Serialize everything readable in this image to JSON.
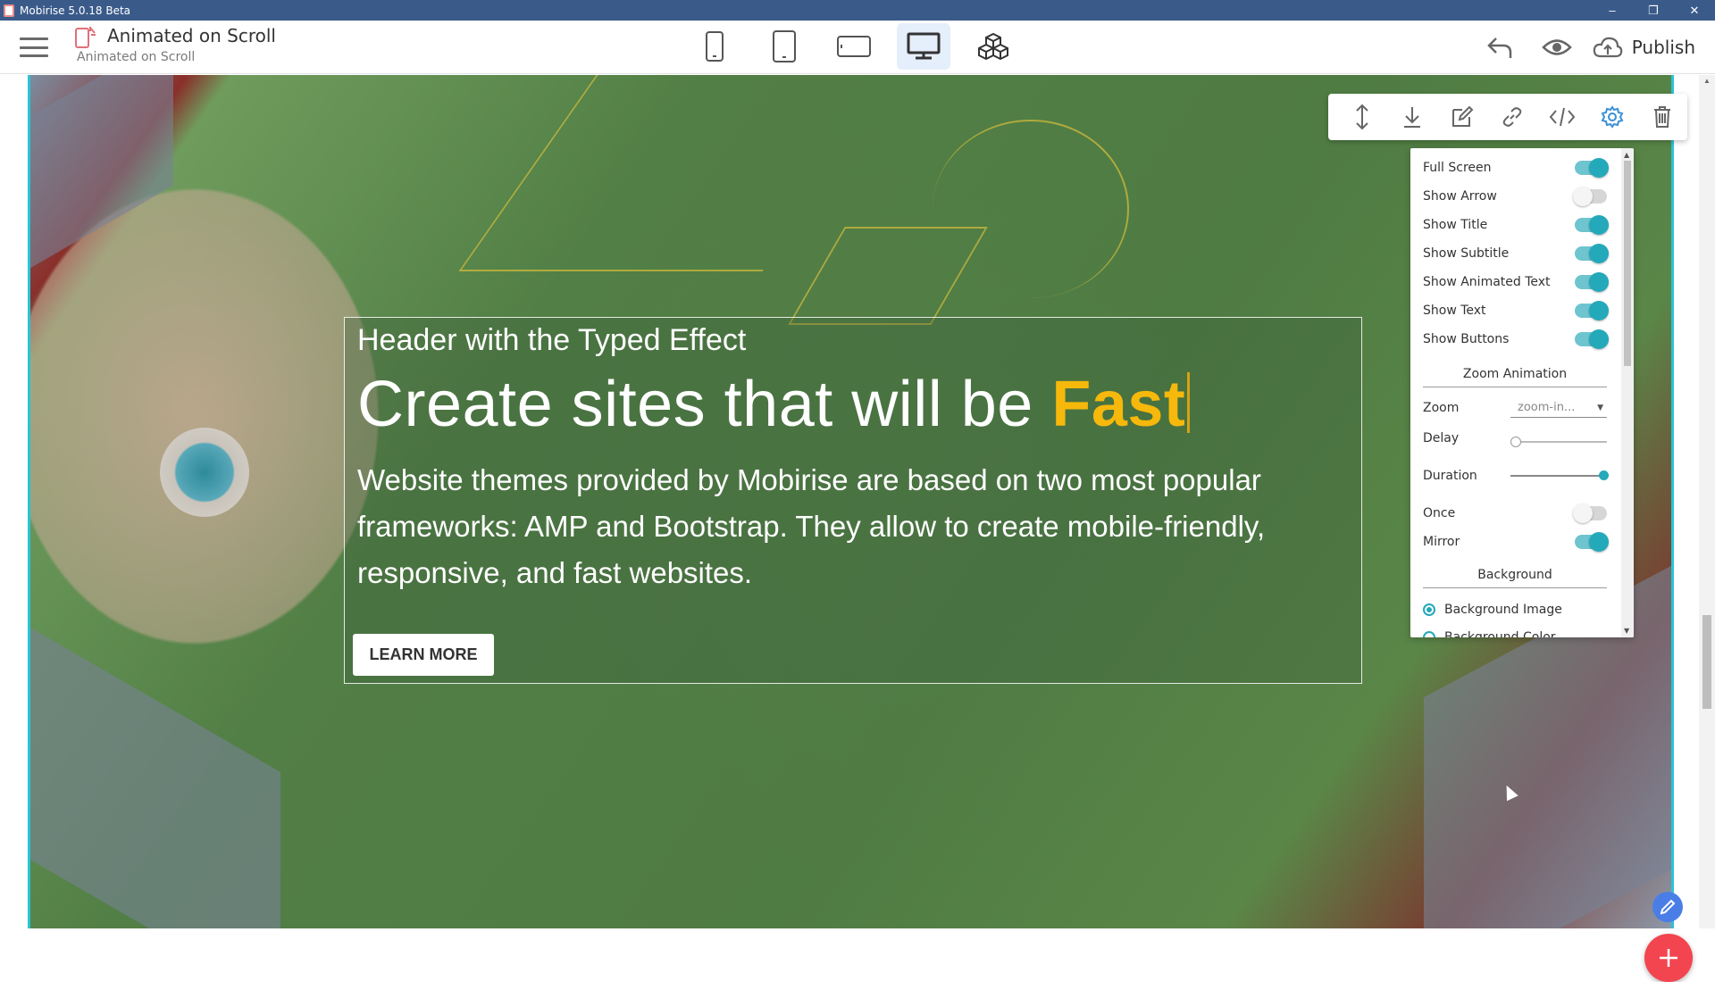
{
  "window": {
    "title": "Mobirise 5.0.18 Beta",
    "controls": [
      "–",
      "❐",
      "✕"
    ]
  },
  "appbar": {
    "page_title": "Animated on Scroll",
    "page_subtitle": "Animated on Scroll",
    "devices": [
      {
        "name": "phone-icon"
      },
      {
        "name": "tablet-icon"
      },
      {
        "name": "tablet-landscape-icon"
      },
      {
        "name": "desktop-icon",
        "active": true
      },
      {
        "name": "blocks-icon"
      }
    ],
    "publish_label": "Publish"
  },
  "hero": {
    "subtitle": "Header with the Typed Effect",
    "title_static": "Create sites that will be ",
    "title_typed": "Fast",
    "text": "Website themes provided by Mobirise are based on two most popular frameworks: AMP and Bootstrap. They allow to create mobile-friendly, responsive, and fast websites.",
    "button_label": "LEARN MORE"
  },
  "toolbar": {
    "icons": [
      "move-icon",
      "download-icon",
      "edit-icon",
      "link-icon",
      "code-icon",
      "gear-icon",
      "trash-icon"
    ]
  },
  "settings": {
    "toggles": [
      {
        "label": "Full Screen",
        "on": true
      },
      {
        "label": "Show Arrow",
        "on": false
      },
      {
        "label": "Show Title",
        "on": true
      },
      {
        "label": "Show Subtitle",
        "on": true
      },
      {
        "label": "Show Animated Text",
        "on": true
      },
      {
        "label": "Show Text",
        "on": true
      },
      {
        "label": "Show Buttons",
        "on": true
      }
    ],
    "zoom_section": "Zoom Animation",
    "zoom_label": "Zoom",
    "zoom_value": "zoom-in...",
    "delay_label": "Delay",
    "delay_value": 0,
    "duration_label": "Duration",
    "duration_value": 1,
    "once_label": "Once",
    "once_on": false,
    "mirror_label": "Mirror",
    "mirror_on": true,
    "background_section": "Background",
    "bg_option_1": "Background Image",
    "bg_option_2": "Background Color"
  },
  "colors": {
    "accent": "#23a9ba",
    "typed_text": "#f6b80b",
    "titlebar": "#3a5b8a",
    "fab_add": "#f2454f",
    "fab_edit": "#4a7ee6"
  }
}
